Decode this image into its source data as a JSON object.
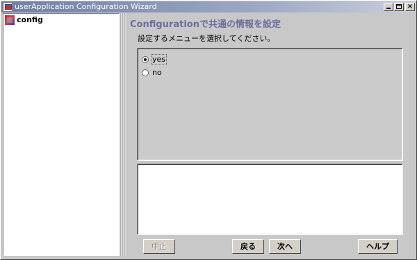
{
  "window": {
    "title": "userApplication Configuration Wizard"
  },
  "tree": {
    "root_label": "config"
  },
  "main": {
    "heading": "Configurationで共通の情報を設定",
    "instruction": "設定するメニューを選択してください。",
    "options": [
      {
        "label": "yes",
        "selected": true
      },
      {
        "label": "no",
        "selected": false
      }
    ],
    "description": ""
  },
  "buttons": {
    "cancel": "中止",
    "back": "戻る",
    "next": "次へ",
    "help": "ヘルプ"
  },
  "colors": {
    "heading": "#6a6f9e",
    "titlebar_start": "#6f7fa6"
  },
  "icons": {
    "window_icon": "app-icon",
    "tree_icon": "config-node-icon"
  }
}
